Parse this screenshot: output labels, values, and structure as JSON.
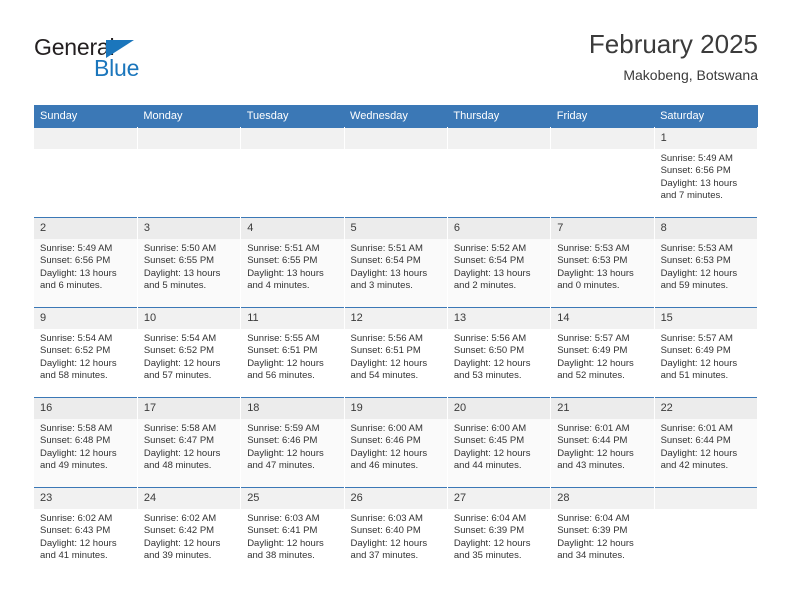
{
  "brand": {
    "name_part1": "General",
    "name_part2": "Blue",
    "triangle_color": "#1b76bc"
  },
  "header": {
    "title": "February 2025",
    "subtitle": "Makobeng, Botswana",
    "accent_color": "#3b78b6"
  },
  "weekday_headers": [
    "Sunday",
    "Monday",
    "Tuesday",
    "Wednesday",
    "Thursday",
    "Friday",
    "Saturday"
  ],
  "weeks": [
    [
      {
        "day": "",
        "sunrise": "",
        "sunset": "",
        "daylight1": "",
        "daylight2": ""
      },
      {
        "day": "",
        "sunrise": "",
        "sunset": "",
        "daylight1": "",
        "daylight2": ""
      },
      {
        "day": "",
        "sunrise": "",
        "sunset": "",
        "daylight1": "",
        "daylight2": ""
      },
      {
        "day": "",
        "sunrise": "",
        "sunset": "",
        "daylight1": "",
        "daylight2": ""
      },
      {
        "day": "",
        "sunrise": "",
        "sunset": "",
        "daylight1": "",
        "daylight2": ""
      },
      {
        "day": "",
        "sunrise": "",
        "sunset": "",
        "daylight1": "",
        "daylight2": ""
      },
      {
        "day": "1",
        "sunrise": "Sunrise: 5:49 AM",
        "sunset": "Sunset: 6:56 PM",
        "daylight1": "Daylight: 13 hours",
        "daylight2": "and 7 minutes."
      }
    ],
    [
      {
        "day": "2",
        "sunrise": "Sunrise: 5:49 AM",
        "sunset": "Sunset: 6:56 PM",
        "daylight1": "Daylight: 13 hours",
        "daylight2": "and 6 minutes."
      },
      {
        "day": "3",
        "sunrise": "Sunrise: 5:50 AM",
        "sunset": "Sunset: 6:55 PM",
        "daylight1": "Daylight: 13 hours",
        "daylight2": "and 5 minutes."
      },
      {
        "day": "4",
        "sunrise": "Sunrise: 5:51 AM",
        "sunset": "Sunset: 6:55 PM",
        "daylight1": "Daylight: 13 hours",
        "daylight2": "and 4 minutes."
      },
      {
        "day": "5",
        "sunrise": "Sunrise: 5:51 AM",
        "sunset": "Sunset: 6:54 PM",
        "daylight1": "Daylight: 13 hours",
        "daylight2": "and 3 minutes."
      },
      {
        "day": "6",
        "sunrise": "Sunrise: 5:52 AM",
        "sunset": "Sunset: 6:54 PM",
        "daylight1": "Daylight: 13 hours",
        "daylight2": "and 2 minutes."
      },
      {
        "day": "7",
        "sunrise": "Sunrise: 5:53 AM",
        "sunset": "Sunset: 6:53 PM",
        "daylight1": "Daylight: 13 hours",
        "daylight2": "and 0 minutes."
      },
      {
        "day": "8",
        "sunrise": "Sunrise: 5:53 AM",
        "sunset": "Sunset: 6:53 PM",
        "daylight1": "Daylight: 12 hours",
        "daylight2": "and 59 minutes."
      }
    ],
    [
      {
        "day": "9",
        "sunrise": "Sunrise: 5:54 AM",
        "sunset": "Sunset: 6:52 PM",
        "daylight1": "Daylight: 12 hours",
        "daylight2": "and 58 minutes."
      },
      {
        "day": "10",
        "sunrise": "Sunrise: 5:54 AM",
        "sunset": "Sunset: 6:52 PM",
        "daylight1": "Daylight: 12 hours",
        "daylight2": "and 57 minutes."
      },
      {
        "day": "11",
        "sunrise": "Sunrise: 5:55 AM",
        "sunset": "Sunset: 6:51 PM",
        "daylight1": "Daylight: 12 hours",
        "daylight2": "and 56 minutes."
      },
      {
        "day": "12",
        "sunrise": "Sunrise: 5:56 AM",
        "sunset": "Sunset: 6:51 PM",
        "daylight1": "Daylight: 12 hours",
        "daylight2": "and 54 minutes."
      },
      {
        "day": "13",
        "sunrise": "Sunrise: 5:56 AM",
        "sunset": "Sunset: 6:50 PM",
        "daylight1": "Daylight: 12 hours",
        "daylight2": "and 53 minutes."
      },
      {
        "day": "14",
        "sunrise": "Sunrise: 5:57 AM",
        "sunset": "Sunset: 6:49 PM",
        "daylight1": "Daylight: 12 hours",
        "daylight2": "and 52 minutes."
      },
      {
        "day": "15",
        "sunrise": "Sunrise: 5:57 AM",
        "sunset": "Sunset: 6:49 PM",
        "daylight1": "Daylight: 12 hours",
        "daylight2": "and 51 minutes."
      }
    ],
    [
      {
        "day": "16",
        "sunrise": "Sunrise: 5:58 AM",
        "sunset": "Sunset: 6:48 PM",
        "daylight1": "Daylight: 12 hours",
        "daylight2": "and 49 minutes."
      },
      {
        "day": "17",
        "sunrise": "Sunrise: 5:58 AM",
        "sunset": "Sunset: 6:47 PM",
        "daylight1": "Daylight: 12 hours",
        "daylight2": "and 48 minutes."
      },
      {
        "day": "18",
        "sunrise": "Sunrise: 5:59 AM",
        "sunset": "Sunset: 6:46 PM",
        "daylight1": "Daylight: 12 hours",
        "daylight2": "and 47 minutes."
      },
      {
        "day": "19",
        "sunrise": "Sunrise: 6:00 AM",
        "sunset": "Sunset: 6:46 PM",
        "daylight1": "Daylight: 12 hours",
        "daylight2": "and 46 minutes."
      },
      {
        "day": "20",
        "sunrise": "Sunrise: 6:00 AM",
        "sunset": "Sunset: 6:45 PM",
        "daylight1": "Daylight: 12 hours",
        "daylight2": "and 44 minutes."
      },
      {
        "day": "21",
        "sunrise": "Sunrise: 6:01 AM",
        "sunset": "Sunset: 6:44 PM",
        "daylight1": "Daylight: 12 hours",
        "daylight2": "and 43 minutes."
      },
      {
        "day": "22",
        "sunrise": "Sunrise: 6:01 AM",
        "sunset": "Sunset: 6:44 PM",
        "daylight1": "Daylight: 12 hours",
        "daylight2": "and 42 minutes."
      }
    ],
    [
      {
        "day": "23",
        "sunrise": "Sunrise: 6:02 AM",
        "sunset": "Sunset: 6:43 PM",
        "daylight1": "Daylight: 12 hours",
        "daylight2": "and 41 minutes."
      },
      {
        "day": "24",
        "sunrise": "Sunrise: 6:02 AM",
        "sunset": "Sunset: 6:42 PM",
        "daylight1": "Daylight: 12 hours",
        "daylight2": "and 39 minutes."
      },
      {
        "day": "25",
        "sunrise": "Sunrise: 6:03 AM",
        "sunset": "Sunset: 6:41 PM",
        "daylight1": "Daylight: 12 hours",
        "daylight2": "and 38 minutes."
      },
      {
        "day": "26",
        "sunrise": "Sunrise: 6:03 AM",
        "sunset": "Sunset: 6:40 PM",
        "daylight1": "Daylight: 12 hours",
        "daylight2": "and 37 minutes."
      },
      {
        "day": "27",
        "sunrise": "Sunrise: 6:04 AM",
        "sunset": "Sunset: 6:39 PM",
        "daylight1": "Daylight: 12 hours",
        "daylight2": "and 35 minutes."
      },
      {
        "day": "28",
        "sunrise": "Sunrise: 6:04 AM",
        "sunset": "Sunset: 6:39 PM",
        "daylight1": "Daylight: 12 hours",
        "daylight2": "and 34 minutes."
      },
      {
        "day": "",
        "sunrise": "",
        "sunset": "",
        "daylight1": "",
        "daylight2": ""
      }
    ]
  ]
}
